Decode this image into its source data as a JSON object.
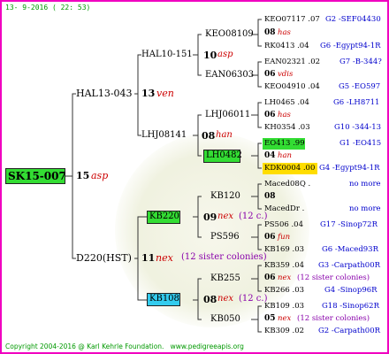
{
  "date": "13- 9-2016 ( 22: 53)",
  "root": {
    "name": "SK15-007",
    "gen": "15",
    "ann": "asp"
  },
  "g1": {
    "p": {
      "name": "HAL13-043",
      "gen": "13",
      "ann": "ven"
    },
    "m": {
      "name": "D220(HST)",
      "gen": "11",
      "ann": "nex",
      "note": "(12 sister colonies)"
    }
  },
  "g2": [
    {
      "name": "HAL10-151",
      "gen": "10",
      "ann": "asp"
    },
    {
      "name": "LHJ08141",
      "gen": "08",
      "ann": "han"
    },
    {
      "name": "KB220",
      "gen": "09",
      "ann": "nex",
      "note": "(12 c.)"
    },
    {
      "name": "KB108",
      "gen": "08",
      "ann": "nex",
      "note": "(12 c.)"
    }
  ],
  "g3": [
    {
      "name": "KEO08109"
    },
    {
      "name": "EAN06303"
    },
    {
      "name": "LHJ06011"
    },
    {
      "name": "LH0482"
    },
    {
      "name": "KB120"
    },
    {
      "name": "PS596"
    },
    {
      "name": "KB255"
    },
    {
      "name": "KB050"
    }
  ],
  "g4": [
    {
      "a": "KEO07117 .07",
      "b": "G2 -SEF04430",
      "gen": "08",
      "ann": "has",
      "c": "RK0413 .04",
      "d": "G6 -Egypt94-1R"
    },
    {
      "a": "EAN02321 .02",
      "b": "G7 -B-344?",
      "gen": "06",
      "ann": "vdis",
      "c": "KEO04910 .04",
      "d": "G5 -EO597"
    },
    {
      "a": "LH0465 .04",
      "b": "G6 -LH8711",
      "gen": "06",
      "ann": "has",
      "c": "KH0354 .03",
      "d": "G10 -344-13"
    },
    {
      "a": "EO413 .99",
      "b": "G1 -EO415",
      "gen": "04",
      "ann": "han",
      "c": "KDK0004 .00",
      "d": "G4 -Egypt94-1R"
    },
    {
      "a": "Maced08Q .",
      "b": "no more",
      "gen": "08",
      "ann": "",
      "c": "MacedDr .",
      "d": "no more"
    },
    {
      "a": "PS506 .04",
      "b": "G17 -Sinop72R",
      "gen": "06",
      "ann": "fun",
      "c": "KB169 .03",
      "d": "G6 -Maced93R"
    },
    {
      "a": "KB359 .04",
      "b": "G3 -Carpath00R",
      "gen": "06",
      "ann": "nex",
      "note": "(12 sister colonies)",
      "c": "KB266 .03",
      "d": "G4 -Sinop96R"
    },
    {
      "a": "KB109 .03",
      "b": "G18 -Sinop62R",
      "gen": "05",
      "ann": "nex",
      "note": "(12 sister colonies)",
      "c": "KB309 .02",
      "d": "G2 -Carpath00R"
    }
  ],
  "footer": {
    "copyright": "Copyright 2004-2016 @ Karl Kehrle Foundation.",
    "url": "www.pedigreeapis.org"
  }
}
